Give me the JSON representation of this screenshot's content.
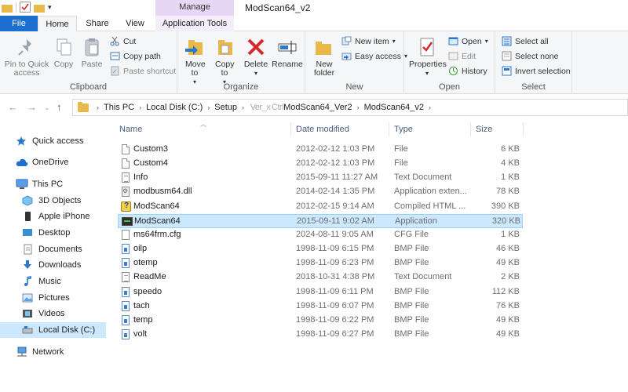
{
  "window": {
    "title": "ModScan64_v2",
    "context_tab_group": "Manage"
  },
  "tabs": {
    "file": "File",
    "home": "Home",
    "share": "Share",
    "view": "View",
    "app_tools": "Application Tools"
  },
  "ribbon": {
    "clipboard": {
      "label": "Clipboard",
      "pin": "Pin to Quick access",
      "copy": "Copy",
      "paste": "Paste",
      "cut": "Cut",
      "copy_path": "Copy path",
      "paste_shortcut": "Paste shortcut"
    },
    "organize": {
      "label": "Organize",
      "move_to": "Move to",
      "copy_to": "Copy to",
      "delete": "Delete",
      "rename": "Rename"
    },
    "new": {
      "label": "New",
      "new_folder": "New folder",
      "new_item": "New item",
      "easy_access": "Easy access"
    },
    "open": {
      "label": "Open",
      "properties": "Properties",
      "open": "Open",
      "edit": "Edit",
      "history": "History"
    },
    "select": {
      "label": "Select",
      "select_all": "Select all",
      "select_none": "Select none",
      "invert": "Invert selection"
    }
  },
  "address": {
    "crumbs": [
      "This PC",
      "Local Disk (C:)",
      "Setup",
      "      ModScan64_Ver2",
      "ModScan64_v2"
    ],
    "crumb3_prefix": " Ver_x Ctrl",
    "crumb3_main": "ModScan64_Ver2"
  },
  "nav": {
    "quick_access": "Quick access",
    "onedrive": "OneDrive",
    "this_pc": "This PC",
    "objects3d": "3D Objects",
    "iphone": "Apple iPhone",
    "desktop": "Desktop",
    "documents": "Documents",
    "downloads": "Downloads",
    "music": "Music",
    "pictures": "Pictures",
    "videos": "Videos",
    "local_disk": "Local Disk (C:)",
    "network": "Network"
  },
  "columns": {
    "name": "Name",
    "date": "Date modified",
    "type": "Type",
    "size": "Size"
  },
  "files": [
    {
      "name": "Custom3",
      "date": "2012-02-12 1:03 PM",
      "type": "File",
      "size": "6 KB",
      "icon": "blank-file-icon"
    },
    {
      "name": "Custom4",
      "date": "2012-02-12 1:03 PM",
      "type": "File",
      "size": "4 KB",
      "icon": "blank-file-icon"
    },
    {
      "name": "Info",
      "date": "2015-09-11 11:27 AM",
      "type": "Text Document",
      "size": "1 KB",
      "icon": "text-document-icon"
    },
    {
      "name": "modbusm64.dll",
      "date": "2014-02-14 1:35 PM",
      "type": "Application exten...",
      "size": "78 KB",
      "icon": "dll-icon"
    },
    {
      "name": "ModScan64",
      "date": "2012-02-15 9:14 AM",
      "type": "Compiled HTML ...",
      "size": "390 KB",
      "icon": "chm-help-icon"
    },
    {
      "name": "ModScan64",
      "date": "2015-09-11 9:02 AM",
      "type": "Application",
      "size": "320 KB",
      "icon": "application-icon"
    },
    {
      "name": "ms64frm.cfg",
      "date": "2024-08-11 9:05 AM",
      "type": "CFG File",
      "size": "1 KB",
      "icon": "cfg-file-icon"
    },
    {
      "name": "oilp",
      "date": "1998-11-09 6:15 PM",
      "type": "BMP File",
      "size": "46 KB",
      "icon": "bmp-file-icon"
    },
    {
      "name": "otemp",
      "date": "1998-11-09 6:23 PM",
      "type": "BMP File",
      "size": "49 KB",
      "icon": "bmp-file-icon"
    },
    {
      "name": "ReadMe",
      "date": "2018-10-31 4:38 PM",
      "type": "Text Document",
      "size": "2 KB",
      "icon": "text-document-icon"
    },
    {
      "name": "speedo",
      "date": "1998-11-09 6:11 PM",
      "type": "BMP File",
      "size": "112 KB",
      "icon": "bmp-file-icon"
    },
    {
      "name": "tach",
      "date": "1998-11-09 6:07 PM",
      "type": "BMP File",
      "size": "76 KB",
      "icon": "bmp-file-icon"
    },
    {
      "name": "temp",
      "date": "1998-11-09 6:22 PM",
      "type": "BMP File",
      "size": "49 KB",
      "icon": "bmp-file-icon"
    },
    {
      "name": "volt",
      "date": "1998-11-09 6:27 PM",
      "type": "BMP File",
      "size": "49 KB",
      "icon": "bmp-file-icon"
    }
  ],
  "selected_file_index": 5,
  "colors": {
    "file_tab": "#1a6fd0",
    "manage_tab": "#e7d7f4",
    "selection": "#cce8ff",
    "selection_border": "#99d1ff",
    "folder": "#e8b94a"
  }
}
